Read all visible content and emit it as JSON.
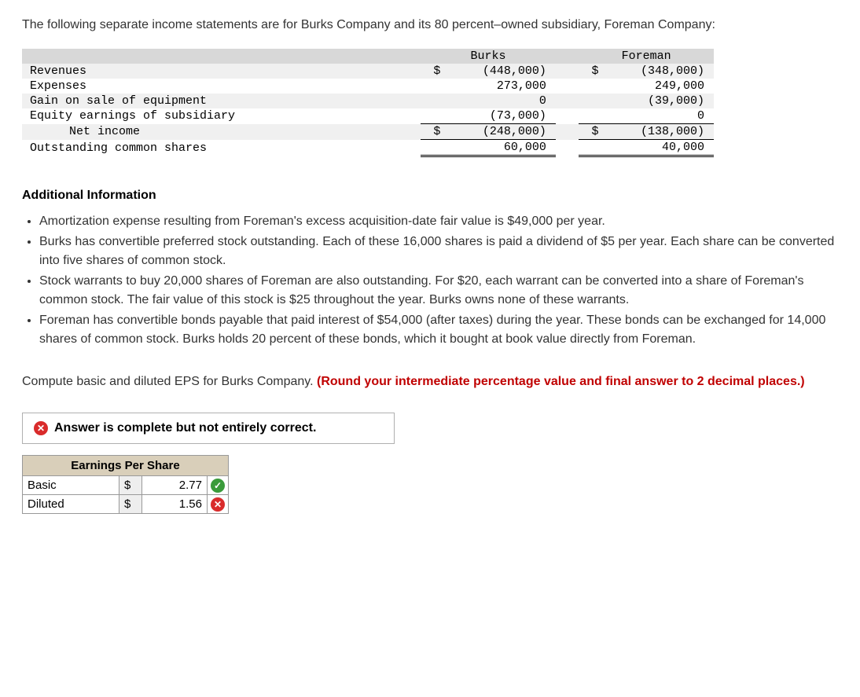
{
  "intro": "The following separate income statements are for Burks Company and its 80 percent–owned subsidiary, Foreman Company:",
  "table": {
    "headers": {
      "col1": "Burks",
      "col2": "Foreman"
    },
    "rows": {
      "revenues": {
        "label": "Revenues",
        "burks_cur": "$",
        "burks": "(448,000)",
        "foreman_cur": "$",
        "foreman": "(348,000)"
      },
      "expenses": {
        "label": "Expenses",
        "burks_cur": "",
        "burks": "273,000",
        "foreman_cur": "",
        "foreman": "249,000"
      },
      "gain": {
        "label": "Gain on sale of equipment",
        "burks_cur": "",
        "burks": "0",
        "foreman_cur": "",
        "foreman": "(39,000)"
      },
      "equity": {
        "label": "Equity earnings of subsidiary",
        "burks_cur": "",
        "burks": "(73,000)",
        "foreman_cur": "",
        "foreman": "0"
      },
      "netincome": {
        "label": "Net income",
        "burks_cur": "$",
        "burks": "(248,000)",
        "foreman_cur": "$",
        "foreman": "(138,000)"
      },
      "shares": {
        "label": "Outstanding common shares",
        "burks_cur": "",
        "burks": "60,000",
        "foreman_cur": "",
        "foreman": "40,000"
      }
    }
  },
  "additional_header": "Additional Information",
  "info_items": {
    "i1": "Amortization expense resulting from Foreman's excess acquisition-date fair value is $49,000 per year.",
    "i2": "Burks has convertible preferred stock outstanding. Each of these 16,000 shares is paid a dividend of $5 per year. Each share can be converted into five shares of common stock.",
    "i3": "Stock warrants to buy 20,000 shares of Foreman are also outstanding. For $20, each warrant can be converted into a share of Foreman's common stock. The fair value of this stock is $25 throughout the year. Burks owns none of these warrants.",
    "i4": "Foreman has convertible bonds payable that paid interest of $54,000 (after taxes) during the year. These bonds can be exchanged for 14,000 shares of common stock. Burks holds 20 percent of these bonds, which it bought at book value directly from Foreman."
  },
  "compute": {
    "text": "Compute basic and diluted EPS for Burks Company. ",
    "hint": "(Round your intermediate percentage value and final answer to 2 decimal places.)"
  },
  "answer_banner": "Answer is complete but not entirely correct.",
  "eps": {
    "header": "Earnings Per Share",
    "basic_label": "Basic",
    "basic_cur": "$",
    "basic_value": "2.77",
    "diluted_label": "Diluted",
    "diluted_cur": "$",
    "diluted_value": "1.56"
  }
}
